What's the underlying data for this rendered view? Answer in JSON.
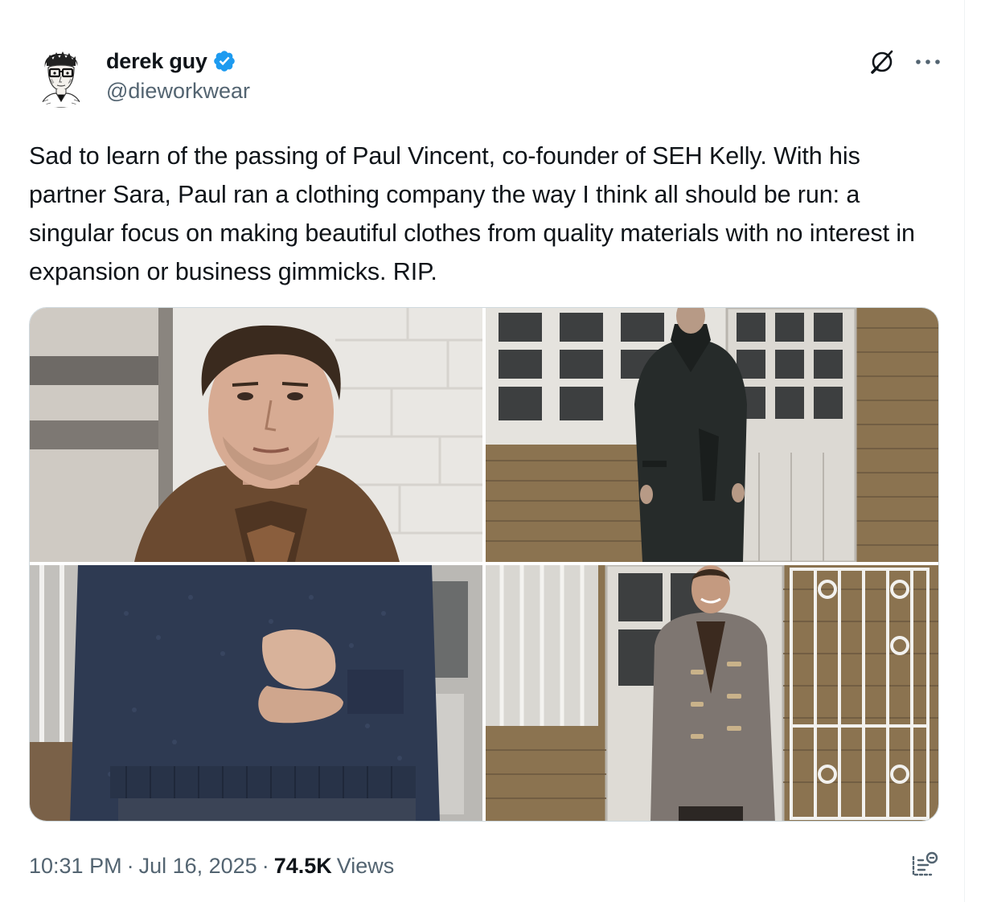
{
  "author": {
    "display_name": "derek guy",
    "handle": "@dieworkwear",
    "verified": true,
    "avatar_icon": "sketch-portrait-avatar"
  },
  "actions": {
    "grok_icon": "grok-icon",
    "more_icon": "more-options-icon"
  },
  "tweet": {
    "text": "Sad to learn of the passing of Paul Vincent, co-founder of SEH Kelly. With his partner Sara, Paul ran a clothing company the way I think all should be run: a singular focus on making beautiful clothes from quality materials with no interest in expansion or business gimmicks. RIP."
  },
  "media": {
    "count": 4,
    "items": [
      {
        "icon": "photo-man-brown-jacket"
      },
      {
        "icon": "photo-man-black-coat"
      },
      {
        "icon": "photo-navy-knit-sweater"
      },
      {
        "icon": "photo-man-duffle-coat"
      }
    ]
  },
  "meta": {
    "time": "10:31 PM",
    "separator": "·",
    "date": "Jul 16, 2025",
    "views_count": "74.5K",
    "views_label": "Views",
    "stats_icon": "post-analytics-icon"
  },
  "colors": {
    "text_primary": "#0f1419",
    "text_secondary": "#536471",
    "verified_blue": "#1d9bf0",
    "border": "#cfd9de"
  }
}
